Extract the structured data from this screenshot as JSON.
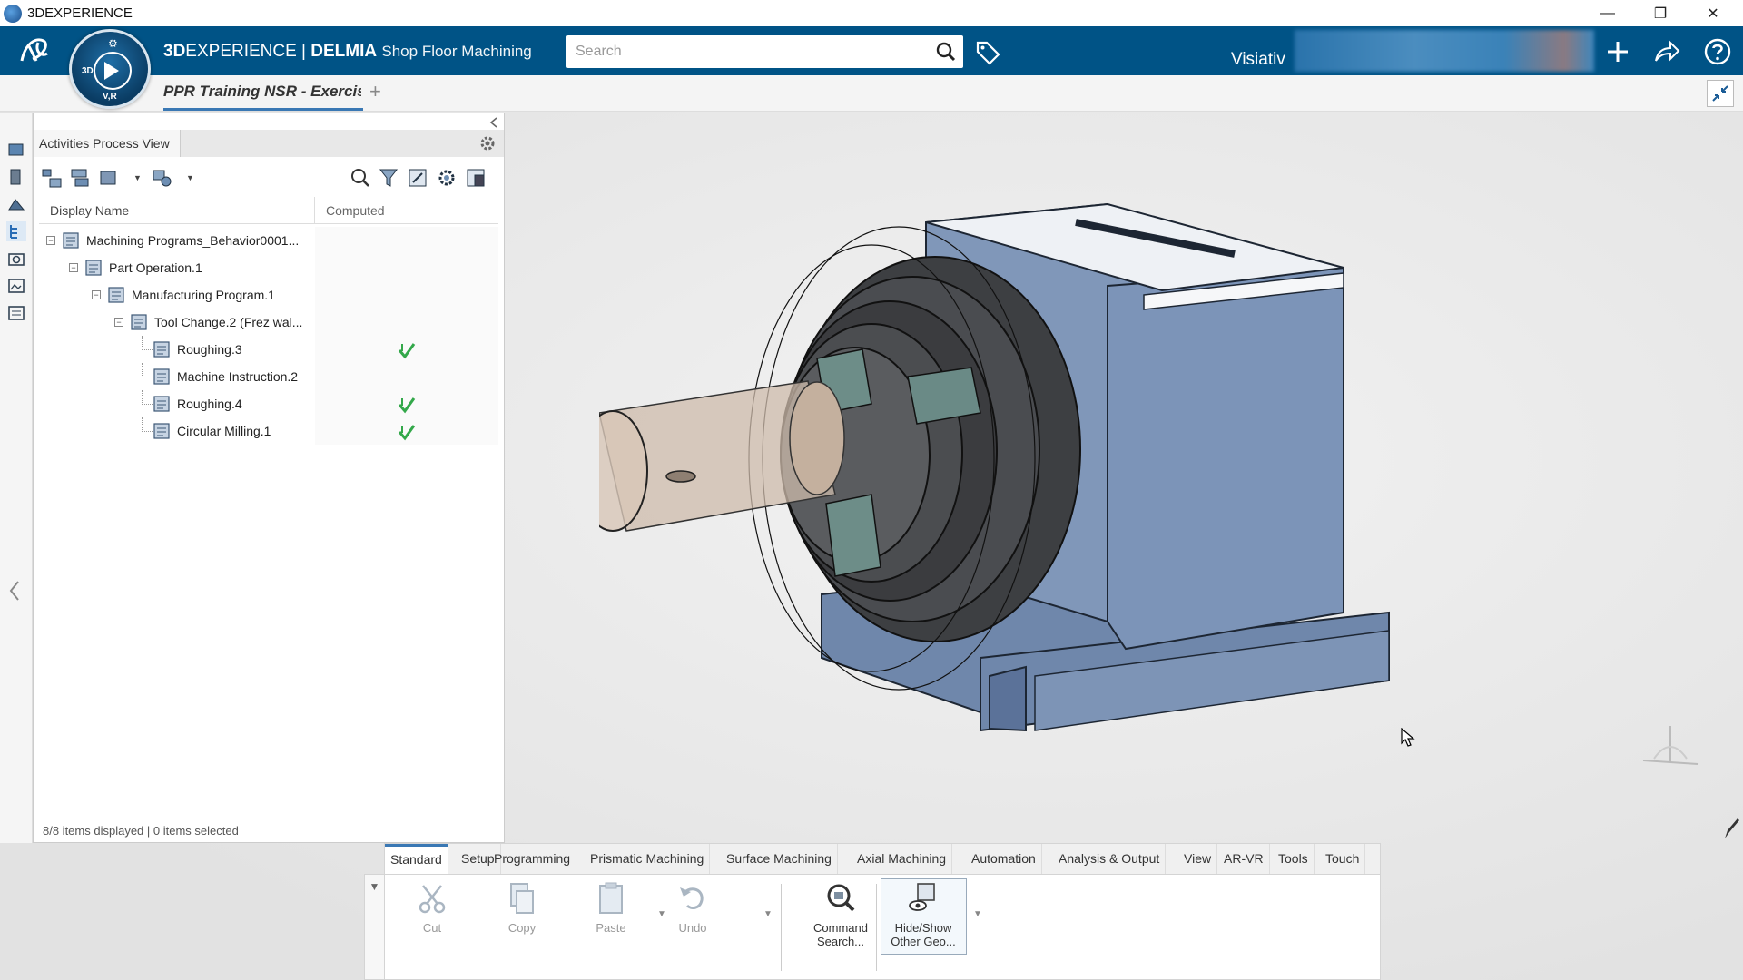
{
  "window": {
    "title": "3DEXPERIENCE",
    "controls": {
      "minimize": "—",
      "restore": "❐",
      "close": "✕"
    }
  },
  "topbar": {
    "brand_bold": "3D",
    "brand_rest": "EXPERIENCE | ",
    "brand_delmia": "DELMIA",
    "app_name": "Shop Floor Machining",
    "search_placeholder": "Search",
    "user": "Visiativ",
    "compass_labels": {
      "left": "3D",
      "bottom": "V,R"
    },
    "accent": "#005386"
  },
  "tabs": {
    "document_tab": "PPR Training NSR - Exercis",
    "add_tab": "+"
  },
  "panel": {
    "title": "Activities Process View",
    "columns": {
      "name": "Display Name",
      "computed": "Computed"
    },
    "tree": [
      {
        "label": "Machining Programs_Behavior0001...",
        "level": 0,
        "expander": "−",
        "icon": "machining-programs-icon",
        "computed": false
      },
      {
        "label": "Part Operation.1",
        "level": 1,
        "expander": "−",
        "icon": "part-operation-icon",
        "computed": false
      },
      {
        "label": "Manufacturing Program.1",
        "level": 2,
        "expander": "−",
        "icon": "manufacturing-program-icon",
        "computed": false
      },
      {
        "label": "Tool Change.2 (Frez wal...",
        "level": 3,
        "expander": "−",
        "icon": "tool-change-icon",
        "computed": false
      },
      {
        "label": "Roughing.3",
        "level": 4,
        "expander": "",
        "icon": "roughing-icon",
        "computed": true
      },
      {
        "label": "Machine Instruction.2",
        "level": 4,
        "expander": "",
        "icon": "machine-instruction-icon",
        "computed": false
      },
      {
        "label": "Roughing.4",
        "level": 4,
        "expander": "",
        "icon": "roughing-icon",
        "computed": true
      },
      {
        "label": "Circular Milling.1",
        "level": 4,
        "expander": "",
        "icon": "circular-milling-icon",
        "computed": true
      }
    ],
    "status": "8/8 items displayed | 0 items selected"
  },
  "ribbon": {
    "tabs": [
      "Standard",
      "Setup",
      "Programming",
      "Prismatic Machining",
      "Surface Machining",
      "Axial Machining",
      "Automation",
      "Analysis & Output",
      "View",
      "AR-VR",
      "Tools",
      "Touch"
    ],
    "active_tab": "Standard",
    "commands": [
      {
        "label": "Cut",
        "icon": "scissors-icon",
        "enabled": false
      },
      {
        "label": "Copy",
        "icon": "copy-icon",
        "enabled": false
      },
      {
        "label": "Paste",
        "icon": "paste-icon",
        "enabled": false
      },
      {
        "label": "Undo",
        "icon": "undo-icon",
        "enabled": false
      },
      {
        "label": "Command Search...",
        "icon": "command-search-icon",
        "enabled": true
      },
      {
        "label": "Hide/Show Other Geo...",
        "icon": "hide-show-icon",
        "enabled": true
      }
    ]
  }
}
